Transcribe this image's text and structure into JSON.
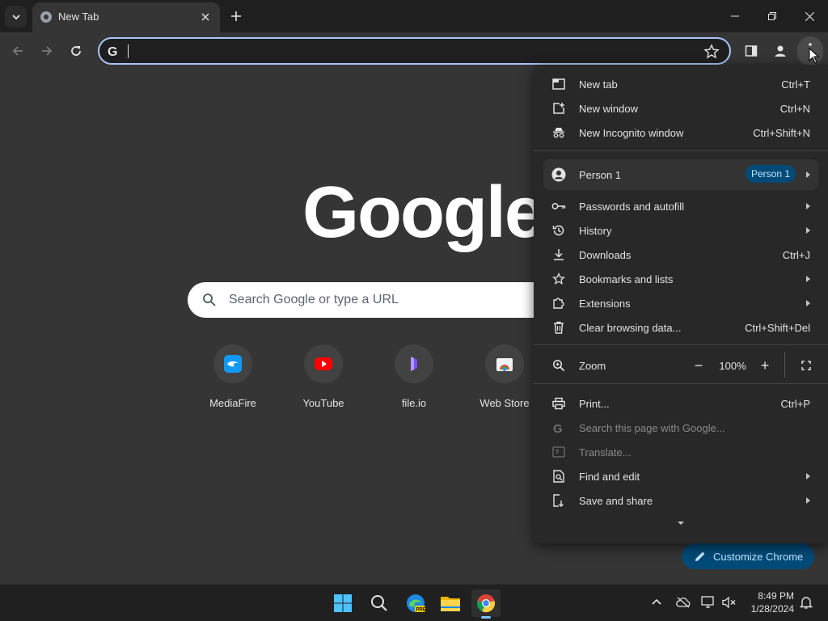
{
  "tabs": [
    {
      "title": "New Tab"
    }
  ],
  "omnibox": {
    "value": ""
  },
  "content": {
    "logo": "Google",
    "search_placeholder": "Search Google or type a URL",
    "shortcuts": [
      {
        "label": "MediaFire",
        "icon": "mediafire-icon"
      },
      {
        "label": "YouTube",
        "icon": "youtube-icon"
      },
      {
        "label": "file.io",
        "icon": "fileio-icon"
      },
      {
        "label": "Web Store",
        "icon": "webstore-icon"
      }
    ],
    "customize_label": "Customize Chrome"
  },
  "menu": {
    "items": [
      {
        "label": "New tab",
        "shortcut": "Ctrl+T"
      },
      {
        "label": "New window",
        "shortcut": "Ctrl+N"
      },
      {
        "label": "New Incognito window",
        "shortcut": "Ctrl+Shift+N"
      }
    ],
    "profile": {
      "label": "Person 1",
      "chip": "Person 1"
    },
    "items2": [
      {
        "label": "Passwords and autofill",
        "shortcut": ""
      },
      {
        "label": "History",
        "shortcut": ""
      },
      {
        "label": "Downloads",
        "shortcut": "Ctrl+J"
      },
      {
        "label": "Bookmarks and lists",
        "shortcut": ""
      },
      {
        "label": "Extensions",
        "shortcut": ""
      },
      {
        "label": "Clear browsing data...",
        "shortcut": "Ctrl+Shift+Del"
      }
    ],
    "zoom": {
      "label": "Zoom",
      "value": "100%",
      "minus": "−",
      "plus": "+"
    },
    "items3": [
      {
        "label": "Print...",
        "shortcut": "Ctrl+P"
      },
      {
        "label": "Search this page with Google...",
        "shortcut": ""
      },
      {
        "label": "Translate...",
        "shortcut": ""
      },
      {
        "label": "Find and edit",
        "shortcut": ""
      },
      {
        "label": "Save and share",
        "shortcut": ""
      }
    ]
  },
  "taskbar": {
    "time": "8:49 PM",
    "date": "1/28/2024"
  },
  "colors": {
    "accent": "#a8c7fa",
    "chip_bg": "#004a77",
    "chip_text": "#c2e7ff"
  }
}
